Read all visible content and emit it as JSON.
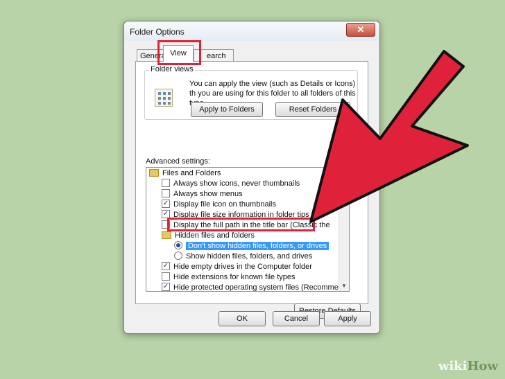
{
  "dialog": {
    "title": "Folder Options",
    "close_label": "✕"
  },
  "tabs": [
    "Genera",
    "View",
    "earch"
  ],
  "folder_views": {
    "label": "Folder views",
    "description": "You can apply the view (such as Details or Icons) th you are using for this folder to all folders of this type",
    "apply_button": "Apply to Folders",
    "reset_button": "Reset Folders"
  },
  "advanced": {
    "label": "Advanced settings:",
    "items": [
      {
        "type": "folder",
        "label": "Files and Folders"
      },
      {
        "type": "checkbox",
        "checked": false,
        "label": "Always show icons, never thumbnails"
      },
      {
        "type": "checkbox",
        "checked": false,
        "label": "Always show menus"
      },
      {
        "type": "checkbox",
        "checked": true,
        "label": "Display file icon on thumbnails"
      },
      {
        "type": "checkbox",
        "checked": true,
        "label": "Display file size information in folder tips"
      },
      {
        "type": "checkbox",
        "checked": false,
        "label": "Display the full path in the title bar (Classic the"
      },
      {
        "type": "folder",
        "label": "Hidden files and folders"
      },
      {
        "type": "radio",
        "checked": true,
        "label": "Don't show hidden files, folders, or drives"
      },
      {
        "type": "radio",
        "checked": false,
        "label": "Show hidden files, folders, and drives"
      },
      {
        "type": "checkbox",
        "checked": true,
        "label": "Hide empty drives in the Computer folder"
      },
      {
        "type": "checkbox",
        "checked": false,
        "label": "Hide extensions for known file types"
      },
      {
        "type": "checkbox",
        "checked": true,
        "label": "Hide protected operating system files (Recommended)"
      }
    ]
  },
  "buttons": {
    "restore": "Restore Defaults",
    "ok": "OK",
    "cancel": "Cancel",
    "apply": "Apply"
  },
  "watermark": {
    "part1": "wiki",
    "part2": "How"
  },
  "colors": {
    "background": "#b9d3a8",
    "highlight_red": "#e0213a",
    "selection_blue": "#3399ff"
  }
}
